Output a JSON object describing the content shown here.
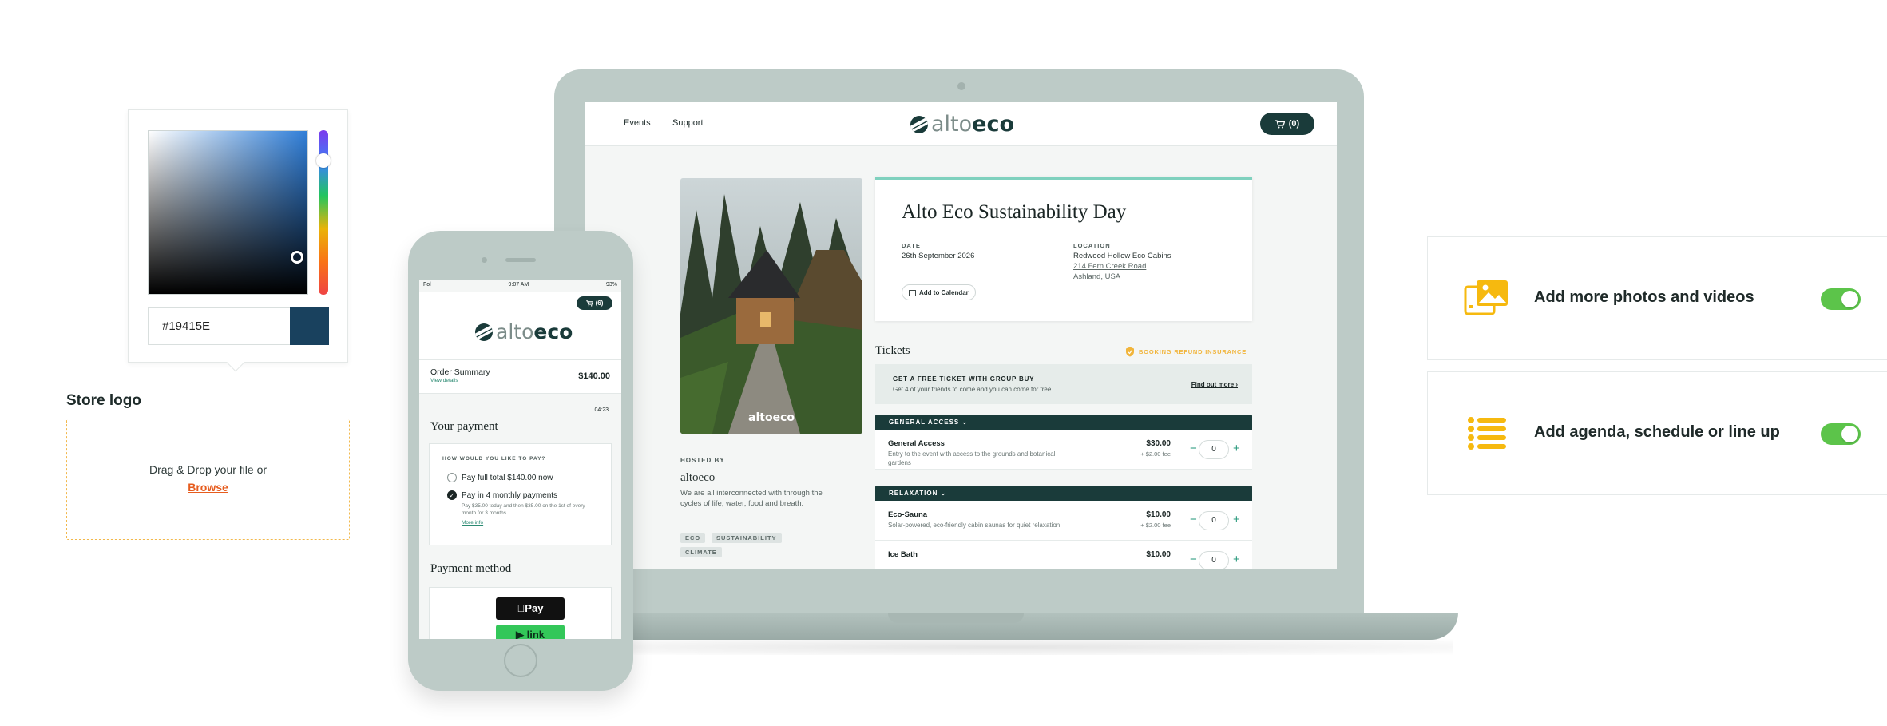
{
  "color_picker": {
    "hex_value": "#19415E",
    "selected_color": "#19415E"
  },
  "store_logo": {
    "title": "Store logo",
    "drop_text": "Drag & Drop your file or",
    "browse_label": "Browse"
  },
  "site": {
    "nav": {
      "events": "Events",
      "support": "Support"
    },
    "brand": {
      "part1": "alto",
      "part2": "eco"
    },
    "cart": "(0)",
    "event": {
      "title": "Alto Eco Sustainability Day",
      "date_label": "DATE",
      "date": "26th September 2026",
      "location_label": "LOCATION",
      "location_name": "Redwood Hollow Eco Cabins",
      "address_1": "214 Fern Creek Road",
      "address_2": "Ashland, USA",
      "add_to_calendar": "Add to Calendar"
    },
    "photo_watermark": "altoeco",
    "host": {
      "label": "HOSTED BY",
      "name": "altoeco",
      "description": "We are all interconnected with through the cycles of life, water, food and breath.",
      "tags": [
        "ECO",
        "SUSTAINABILITY",
        "CLIMATE"
      ]
    },
    "tickets": {
      "title": "Tickets",
      "refund_badge": "BOOKING REFUND INSURANCE",
      "promo_title": "GET A FREE TICKET WITH GROUP BUY",
      "promo_sub": "Get 4 of your friends to come and you can come for free.",
      "promo_link": "Find out more ›",
      "sections": [
        {
          "name": "GENERAL ACCESS"
        },
        {
          "name": "RELAXATION"
        }
      ],
      "items": [
        {
          "name": "General Access",
          "description": "Entry to the event with access to the grounds and botanical gardens",
          "price": "$30.00",
          "fee": "+ $2.00 fee",
          "qty": "0"
        },
        {
          "name": "Eco-Sauna",
          "description": "Solar-powered, eco-friendly cabin saunas for quiet relaxation",
          "price": "$10.00",
          "fee": "+ $2.00 fee",
          "qty": "0"
        },
        {
          "name": "Ice Bath",
          "description": "",
          "price": "$10.00",
          "fee": "",
          "qty": "0"
        }
      ]
    }
  },
  "phone": {
    "status": {
      "carrier": "Fol",
      "time": "9:07 AM",
      "battery": "93%"
    },
    "cart": "(6)",
    "order_summary": {
      "title": "Order Summary",
      "link": "View details",
      "total": "$140.00"
    },
    "timer": "04:23",
    "payment": {
      "title": "Your payment",
      "question": "HOW WOULD YOU LIKE TO PAY?",
      "option_full": "Pay full total $140.00 now",
      "option_monthly": "Pay in 4 monthly payments",
      "monthly_desc": "Pay $35.00 today and then $35.00 on the 1st of every month for 3 months.",
      "more_info": "More info"
    },
    "payment_method": {
      "title": "Payment method",
      "apple_pay": "Pay",
      "link": "link"
    }
  },
  "features": [
    {
      "label": "Add more photos and videos",
      "icon": "photos-icon",
      "enabled": true
    },
    {
      "label": "Add agenda, schedule or line up",
      "icon": "list-icon",
      "enabled": true
    }
  ],
  "colors": {
    "brand_dark": "#1a3b3a",
    "accent_teal": "#7fd1be",
    "accent_yellow": "#f6b90f",
    "toggle_on": "#5cc44a",
    "device": "#bdcbc7",
    "dropzone_border": "#f2b84b",
    "browse_link": "#e65c1e"
  }
}
